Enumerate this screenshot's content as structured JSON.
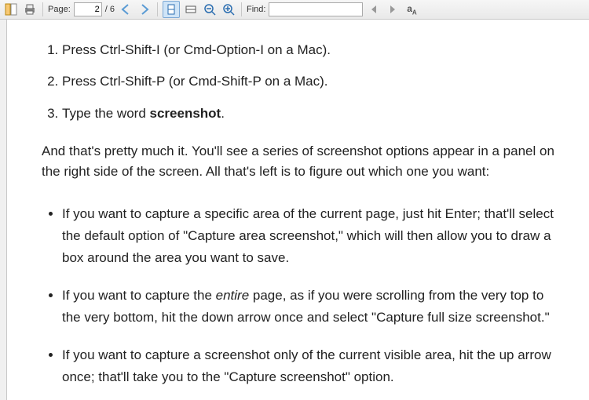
{
  "toolbar": {
    "page_label": "Page:",
    "page_current": "2",
    "page_total": "/ 6",
    "find_label": "Find:",
    "find_value": ""
  },
  "document": {
    "steps": [
      {
        "n": "1",
        "text_before": "Press Ctrl-Shift-I (or Cmd-Option-I on a Mac).",
        "bold": "",
        "text_after": ""
      },
      {
        "n": "2",
        "text_before": "Press Ctrl-Shift-P (or Cmd-Shift-P on a Mac).",
        "bold": "",
        "text_after": ""
      },
      {
        "n": "3",
        "text_before": "Type the word ",
        "bold": "screenshot",
        "text_after": "."
      }
    ],
    "paragraph": "And that's pretty much it. You'll see a series of screenshot options appear in a panel on the right side of the screen. All that's left is to figure out which one you want:",
    "bullets": [
      {
        "pre": "If you want to capture a specific area of the current page, just hit Enter; that'll select the default option of \"Capture area screenshot,\" which will then allow you to draw a box around the area you want to save.",
        "em": "",
        "post": ""
      },
      {
        "pre": "If you want to capture the ",
        "em": "entire",
        "post": " page, as if you were scrolling from the very top to the very bottom, hit the down arrow once and select \"Capture full size screenshot.\""
      },
      {
        "pre": "If you want to capture a screenshot only of the current visible area, hit the up arrow once; that'll take you to the \"Capture screenshot\" option.",
        "em": "",
        "post": ""
      }
    ]
  }
}
